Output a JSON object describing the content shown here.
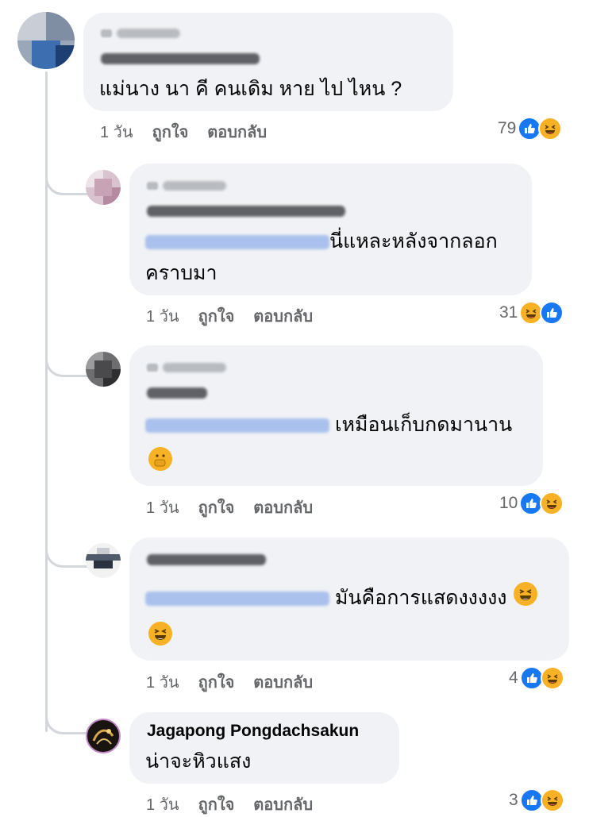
{
  "comments": [
    {
      "text": "แม่นาง นา คี คนเดิม หาย ไป ไหน   ?",
      "time": "1 วัน",
      "like_label": "ถูกใจ",
      "reply_label": "ตอบกลับ",
      "reaction_count": "79",
      "reactions": [
        "like-icon",
        "haha-icon"
      ]
    },
    {
      "text_line1": "นี่แหละหลังจากลอก",
      "text_line2": "คราบมา",
      "time": "1 วัน",
      "like_label": "ถูกใจ",
      "reply_label": "ตอบกลับ",
      "reaction_count": "31",
      "reactions": [
        "haha-icon",
        "like-icon"
      ]
    },
    {
      "text": "เหมือนเก็บกดมานาน",
      "emoji": "hand-over-mouth-emoji",
      "time": "1 วัน",
      "like_label": "ถูกใจ",
      "reply_label": "ตอบกลับ",
      "reaction_count": "10",
      "reactions": [
        "like-icon",
        "haha-icon"
      ]
    },
    {
      "text": "มันคือการแสดงงงงง",
      "emoji": "laughing-emoji",
      "time": "1 วัน",
      "like_label": "ถูกใจ",
      "reply_label": "ตอบกลับ",
      "reaction_count": "4",
      "reactions": [
        "like-icon",
        "haha-icon"
      ]
    },
    {
      "author": "Jagapong Pongdachsakun",
      "text": "น่าจะหิวแสง",
      "time": "1 วัน",
      "like_label": "ถูกใจ",
      "reply_label": "ตอบกลับ",
      "reaction_count": "3",
      "reactions": [
        "like-icon",
        "haha-icon"
      ]
    }
  ],
  "colors": {
    "bubble": "#f0f2f5",
    "meta_text": "#65676b",
    "like_blue": "#1877f2",
    "haha_yellow": "#f7b125",
    "mention_blur": "#a9c1ec"
  }
}
